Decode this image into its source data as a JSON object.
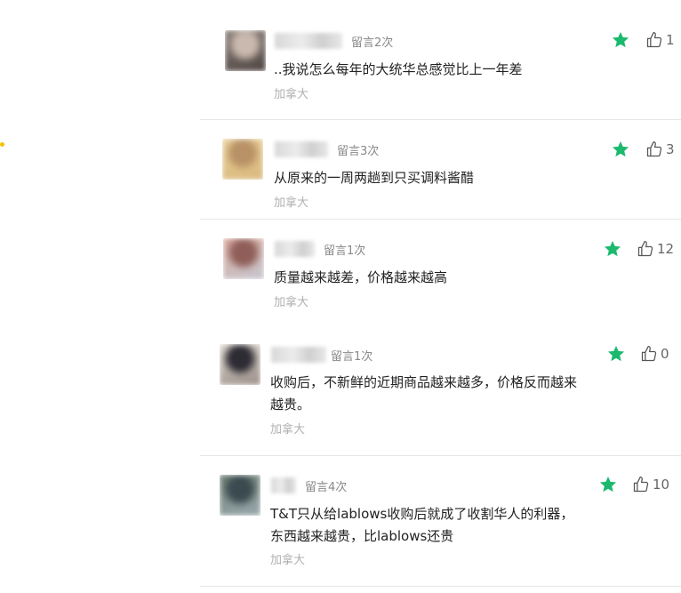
{
  "comments": [
    {
      "count": "留言2次",
      "text": "..我说怎么每年的大统华总感觉比上一年差",
      "location": "加拿大",
      "likes": "1",
      "avatar_colors": [
        "#8a7f79",
        "#c9b9ae",
        "#4f4542"
      ]
    },
    {
      "count": "留言3次",
      "text": "从原来的一周两趟到只买调料酱醋",
      "location": "加拿大",
      "likes": "3",
      "avatar_colors": [
        "#e8d19a",
        "#b89166",
        "#d9b77a"
      ]
    },
    {
      "count": "留言1次",
      "text": "质量越来越差，价格越来越高",
      "location": "加拿大",
      "likes": "12",
      "avatar_colors": [
        "#d9a79c",
        "#8f5e58",
        "#c6c7cf"
      ]
    },
    {
      "count": "留言1次",
      "text": "收购后，不新鲜的近期商品越来越多，价格反而越来\n越贵。",
      "location": "加拿大",
      "likes": "0",
      "avatar_colors": [
        "#dcd7cf",
        "#2d2b33",
        "#9c8f88"
      ]
    },
    {
      "count": "留言4次",
      "text": "T&T只从给lablows收购后就成了收割华人的利器，\n东西越来越贵，比lablows还贵",
      "location": "加拿大",
      "likes": "10",
      "avatar_colors": [
        "#6c7e6f",
        "#3b4a4f",
        "#9aa8ae"
      ]
    }
  ],
  "colors": {
    "star": "#1bb96e",
    "like_icon": "#555555"
  },
  "icons": {
    "star": "star-icon",
    "like": "thumbs-up-icon"
  }
}
